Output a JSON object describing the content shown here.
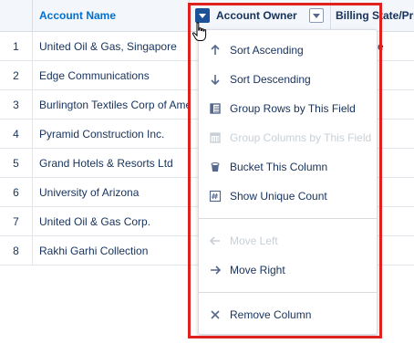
{
  "table": {
    "headers": {
      "name": "Account Name",
      "owner": "Account Owner",
      "billing": "Billing State/Pro"
    },
    "rows": [
      {
        "num": "1",
        "name": "United Oil & Gas, Singapore"
      },
      {
        "num": "2",
        "name": "Edge Communications"
      },
      {
        "num": "3",
        "name": "Burlington Textiles Corp of Amer"
      },
      {
        "num": "4",
        "name": "Pyramid Construction Inc."
      },
      {
        "num": "5",
        "name": "Grand Hotels & Resorts Ltd"
      },
      {
        "num": "6",
        "name": "University of Arizona"
      },
      {
        "num": "7",
        "name": "United Oil & Gas Corp."
      },
      {
        "num": "8",
        "name": "Rakhi Garhi Collection"
      }
    ],
    "partial_text_row1": "e"
  },
  "menu": {
    "items": [
      {
        "label": "Sort Ascending",
        "icon": "arrow-up-icon",
        "enabled": true
      },
      {
        "label": "Sort Descending",
        "icon": "arrow-down-icon",
        "enabled": true
      },
      {
        "label": "Group Rows by This Field",
        "icon": "group-rows-icon",
        "enabled": true
      },
      {
        "label": "Group Columns by This Field",
        "icon": "group-columns-icon",
        "enabled": false
      },
      {
        "label": "Bucket This Column",
        "icon": "bucket-icon",
        "enabled": true
      },
      {
        "label": "Show Unique Count",
        "icon": "unique-count-icon",
        "enabled": true
      },
      {
        "label": "Move Left",
        "icon": "arrow-left-icon",
        "enabled": false
      },
      {
        "label": "Move Right",
        "icon": "arrow-right-icon",
        "enabled": true
      },
      {
        "label": "Remove Column",
        "icon": "close-icon",
        "enabled": true
      }
    ]
  },
  "colors": {
    "link": "#0070d2",
    "text": "#16325c",
    "highlight": "#e0221f",
    "disabled": "#c9cfd6"
  }
}
